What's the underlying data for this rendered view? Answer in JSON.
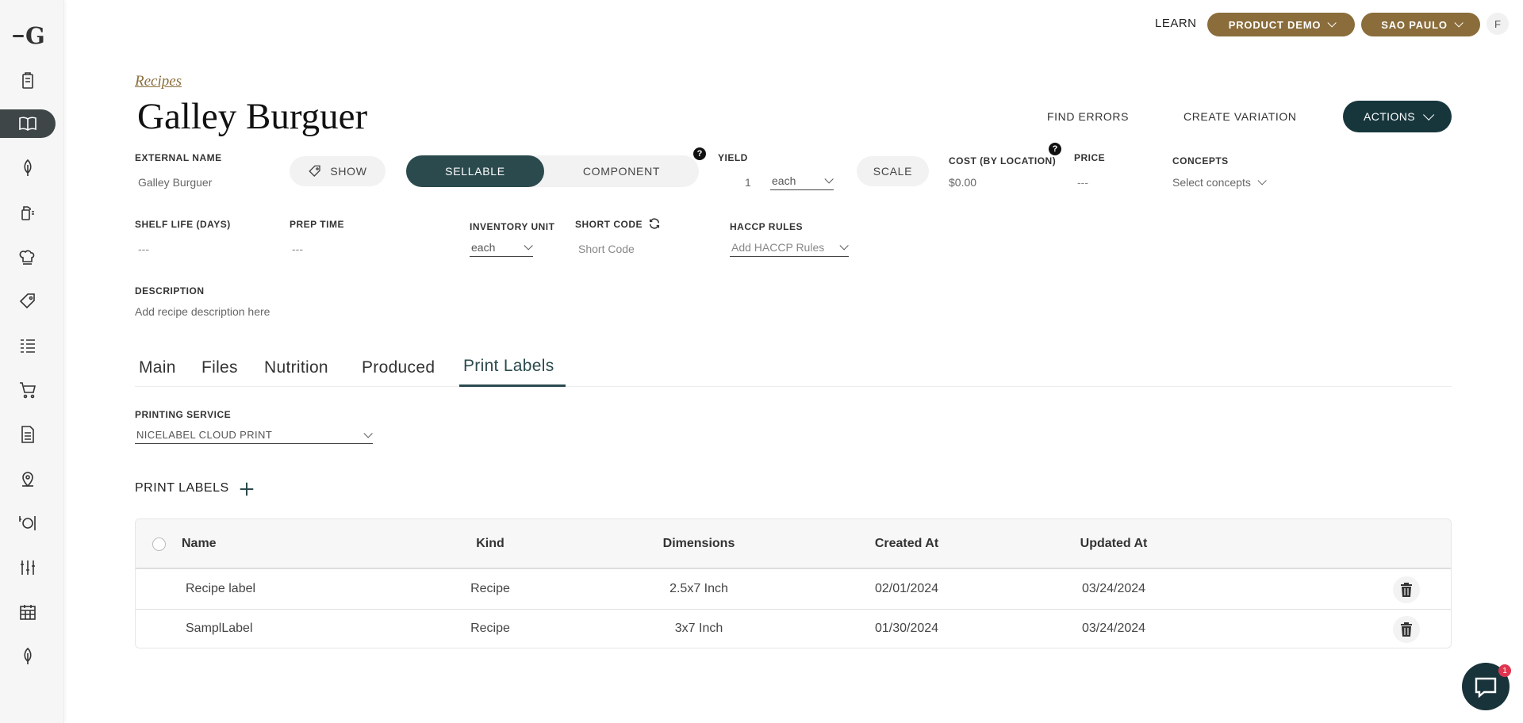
{
  "sidebar": {
    "logo_letter": "G",
    "items": [
      {
        "icon": "clipboard-icon"
      },
      {
        "icon": "book-icon",
        "active": true
      },
      {
        "icon": "leaf-icon"
      },
      {
        "icon": "cleaning-icon"
      },
      {
        "icon": "chef-icon"
      },
      {
        "icon": "tag-icon"
      },
      {
        "icon": "checklist-icon"
      },
      {
        "icon": "cart-icon"
      },
      {
        "icon": "document-icon"
      },
      {
        "icon": "location-pin-icon"
      },
      {
        "icon": "dining-icon"
      },
      {
        "icon": "sliders-icon"
      },
      {
        "icon": "calendar-icon"
      },
      {
        "icon": "leaf-icon"
      }
    ]
  },
  "topbar": {
    "learn": "LEARN",
    "product_demo": "PRODUCT DEMO",
    "location": "SAO PAULO",
    "avatar": "F"
  },
  "header": {
    "breadcrumb": "Recipes",
    "title": "Galley Burguer",
    "find_errors": "FIND ERRORS",
    "create_variation": "CREATE VARIATION",
    "actions": "ACTIONS"
  },
  "fields": {
    "external_name_label": "EXTERNAL NAME",
    "external_name_value": "Galley Burguer",
    "show_button": "SHOW",
    "sellable": "SELLABLE",
    "component": "COMPONENT",
    "help": "?",
    "yield_label": "YIELD",
    "yield_value": "1",
    "yield_unit": "each",
    "scale_button": "SCALE",
    "cost_label": "COST (BY LOCATION)",
    "cost_value": "$0.00",
    "price_label": "PRICE",
    "price_value": "---",
    "concepts_label": "CONCEPTS",
    "concepts_placeholder": "Select concepts",
    "shelf_life_label": "SHELF LIFE (DAYS)",
    "shelf_life_value": "---",
    "prep_time_label": "PREP TIME",
    "prep_time_value": "---",
    "inventory_unit_label": "INVENTORY UNIT",
    "inventory_unit_value": "each",
    "short_code_label": "SHORT CODE",
    "short_code_placeholder": "Short Code",
    "haccp_label": "HACCP RULES",
    "haccp_placeholder": "Add HACCP Rules",
    "description_label": "DESCRIPTION",
    "description_placeholder": "Add recipe description here"
  },
  "tabs": [
    {
      "label": "Main"
    },
    {
      "label": "Files"
    },
    {
      "label": "Nutrition"
    },
    {
      "label": "Produced"
    },
    {
      "label": "Print Labels",
      "active": true
    }
  ],
  "print_labels": {
    "printing_service_label": "PRINTING SERVICE",
    "printing_service_value": "NICELABEL CLOUD PRINT",
    "section_title": "PRINT LABELS",
    "columns": [
      "Name",
      "Kind",
      "Dimensions",
      "Created At",
      "Updated At"
    ],
    "rows": [
      {
        "name": "Recipe label",
        "kind": "Recipe",
        "dimensions": "2.5x7 Inch",
        "created": "02/01/2024",
        "updated": "03/24/2024"
      },
      {
        "name": "SamplLabel",
        "kind": "Recipe",
        "dimensions": "3x7 Inch",
        "created": "01/30/2024",
        "updated": "03/24/2024"
      }
    ]
  },
  "chat": {
    "badge": "1"
  },
  "colors": {
    "accent_gold": "#8a6d3b",
    "dark_teal": "#16363c",
    "active_teal": "#2b4a4e"
  }
}
